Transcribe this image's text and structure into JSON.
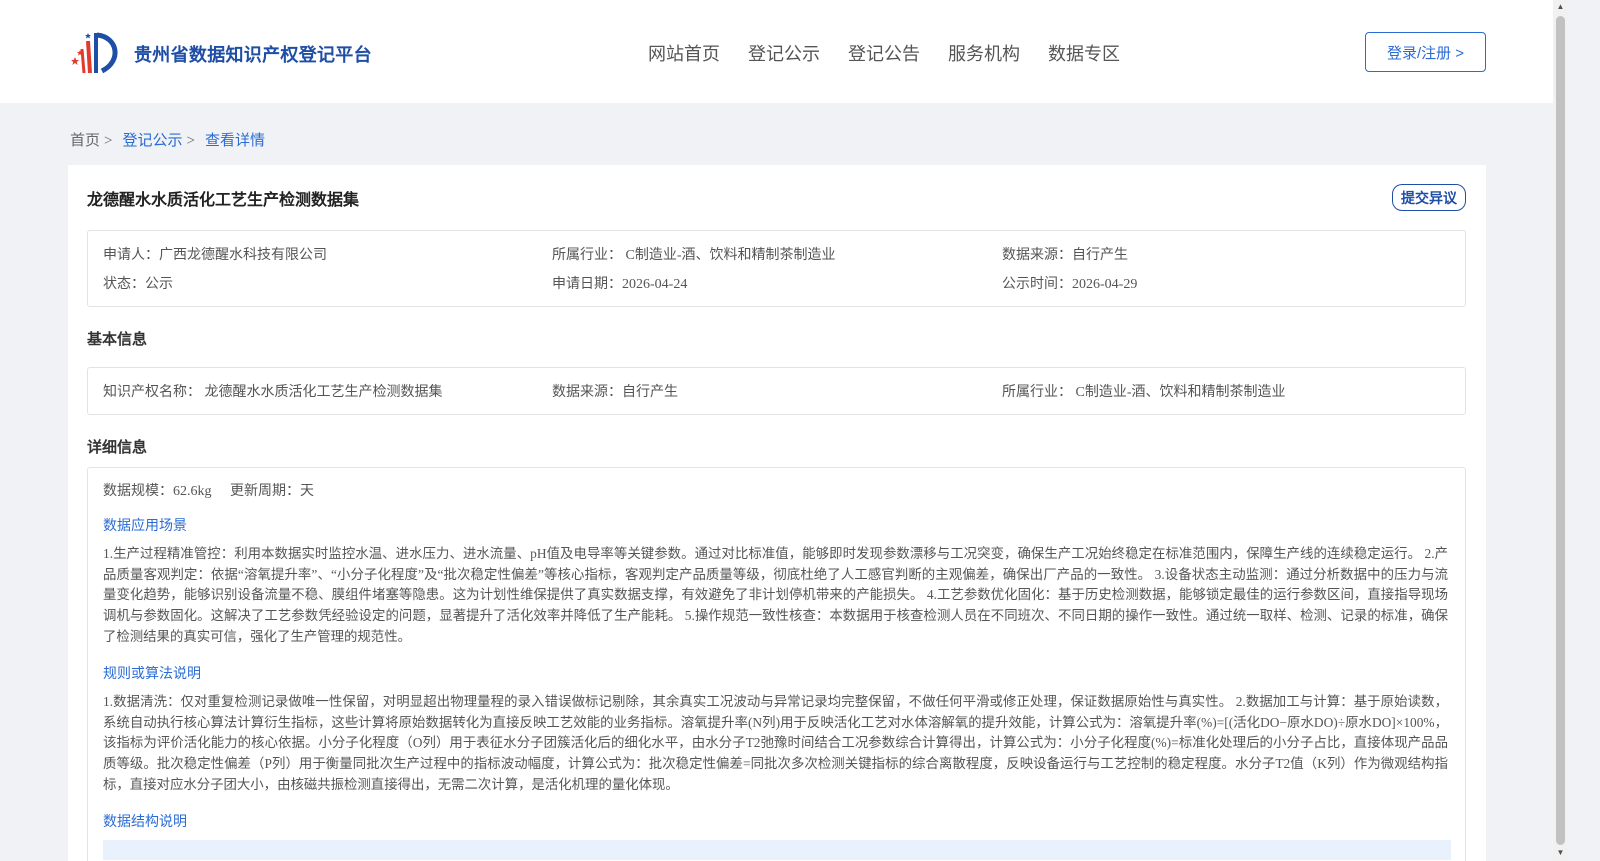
{
  "header": {
    "logo_text": "贵州省数据知识产权登记平台",
    "nav": [
      "网站首页",
      "登记公示",
      "登记公告",
      "服务机构",
      "数据专区"
    ],
    "login_label": "登录/注册 >"
  },
  "breadcrumb": {
    "home": "首页",
    "level1": "登记公示",
    "level2": "查看详情",
    "separator": ">"
  },
  "detail": {
    "title": "龙德醒水水质活化工艺生产检测数据集",
    "objection_label": "提交异议",
    "summary": {
      "applicant": "申请人：广西龙德醒水科技有限公司",
      "industry": "所属行业： C制造业-酒、饮料和精制茶制造业",
      "source": "数据来源：自行产生",
      "status": "状态：公示",
      "apply_date": "申请日期：2026-04-24",
      "publish_date": "公示时间：2026-04-29"
    },
    "basic_section_title": "基本信息",
    "basic": {
      "ip_name": "知识产权名称： 龙德醒水水质活化工艺生产检测数据集",
      "source": "数据来源：自行产生",
      "industry": "所属行业： C制造业-酒、饮料和精制茶制造业"
    },
    "detail_section_title": "详细信息",
    "scale": "数据规模：62.6kg",
    "update_cycle": "更新周期：天",
    "scenario_title": "数据应用场景",
    "scenario_text": "1.生产过程精准管控：利用本数据实时监控水温、进水压力、进水流量、pH值及电导率等关键参数。通过对比标准值，能够即时发现参数漂移与工况突变，确保生产工况始终稳定在标准范围内，保障生产线的连续稳定运行。 2.产品质量客观判定：依据“溶氧提升率”、“小分子化程度”及“批次稳定性偏差”等核心指标，客观判定产品质量等级，彻底杜绝了人工感官判断的主观偏差，确保出厂产品的一致性。 3.设备状态主动监测：通过分析数据中的压力与流量变化趋势，能够识别设备流量不稳、膜组件堵塞等隐患。这为计划性维保提供了真实数据支撑，有效避免了非计划停机带来的产能损失。 4.工艺参数优化固化：基于历史检测数据，能够锁定最佳的运行参数区间，直接指导现场调机与参数固化。这解决了工艺参数凭经验设定的问题，显著提升了活化效率并降低了生产能耗。 5.操作规范一致性核查：本数据用于核查检测人员在不同班次、不同日期的操作一致性。通过统一取样、检测、记录的标准，确保了检测结果的真实可信，强化了生产管理的规范性。",
    "algorithm_title": "规则或算法说明",
    "algorithm_text": "1.数据清洗：仅对重复检测记录做唯一性保留，对明显超出物理量程的录入错误做标记剔除，其余真实工况波动与异常记录均完整保留，不做任何平滑或修正处理，保证数据原始性与真实性。 2.数据加工与计算：基于原始读数，系统自动执行核心算法计算衍生指标，这些计算将原始数据转化为直接反映工艺效能的业务指标。溶氧提升率(N列)用于反映活化工艺对水体溶解氧的提升效能，计算公式为：溶氧提升率(%)=[(活化DO−原水DO)÷原水DO]×100%，该指标为评价活化能力的核心依据。小分子化程度（O列）用于表征水分子团簇活化后的细化水平，由水分子T2弛豫时间结合工况参数综合计算得出，计算公式为：小分子化程度(%)=标准化处理后的小分子占比，直接体现产品品质等级。批次稳定性偏差（P列）用于衡量同批次生产过程中的指标波动幅度，计算公式为：批次稳定性偏差=同批次多次检测关键指标的综合离散程度，反映设备运行与工艺控制的稳定程度。水分子T2值（K列）作为微观结构指标，直接对应水分子团大小，由核磁共振检测直接得出，无需二次计算，是活化机理的量化体现。",
    "structure_title": "数据结构说明"
  },
  "colors": {
    "primary": "#2b6cd4",
    "logo_blue": "#1f4ea6",
    "logo_red": "#e23b2e",
    "background": "#f0f2f5"
  }
}
